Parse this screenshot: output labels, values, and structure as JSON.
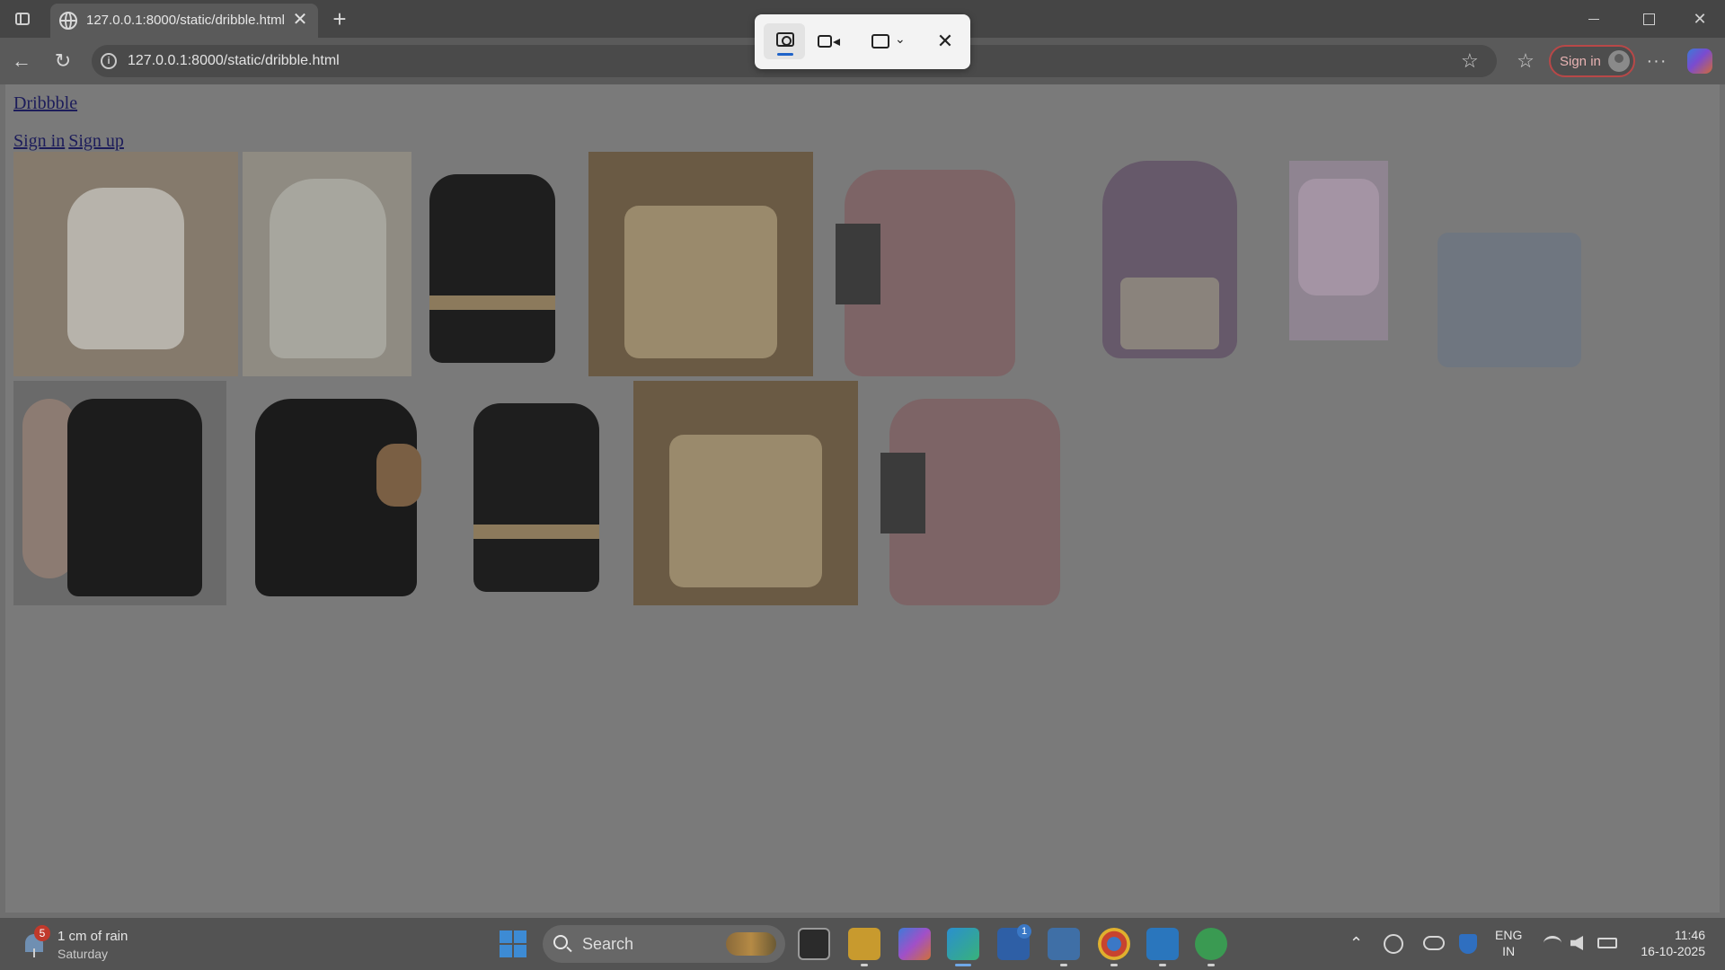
{
  "browser": {
    "tab_title": "127.0.0.1:8000/static/dribble.html",
    "tab_close_glyph": "✕",
    "new_tab_glyph": "+",
    "url": "127.0.0.1:8000/static/dribble.html",
    "info_glyph": "i",
    "back_glyph": "←",
    "refresh_glyph": "↻",
    "star_glyph": "☆",
    "favorites_glyph": "☆",
    "more_glyph": "···",
    "signin_label": "Sign in",
    "close_glyph": "✕"
  },
  "page": {
    "logo_link": "Dribbble",
    "signin_link": "Sign in",
    "signup_link": "Sign up",
    "images": [
      {
        "name": "white-mini-backpack",
        "color": "#8d8a85"
      },
      {
        "name": "cream-blue-backpack",
        "color": "#9e9a8e"
      },
      {
        "name": "black-beige-backpack",
        "color": "#7f7f7f"
      },
      {
        "name": "beige-tote-bear",
        "color": "#8a7558"
      },
      {
        "name": "pink-backpack-scarf",
        "color": "#877274"
      },
      {
        "name": "purple-backpack",
        "color": "#7f7880"
      },
      {
        "name": "pink-floral-backpack",
        "color": "#8d8087"
      },
      {
        "name": "blue-handbag",
        "color": "#7f858c"
      },
      {
        "name": "woman-black-backpack",
        "color": "#6d6d6d"
      },
      {
        "name": "black-bow-backpack-bear",
        "color": "#7a7a7a"
      },
      {
        "name": "black-beige-backpack-2",
        "color": "#7f7f7f"
      },
      {
        "name": "beige-tote-bear-2",
        "color": "#8a7558"
      },
      {
        "name": "pink-backpack-scarf-2",
        "color": "#877274"
      }
    ]
  },
  "snip_tool": {
    "close_glyph": "✕",
    "chevron_glyph": "⌄"
  },
  "taskbar": {
    "weather_badge": "5",
    "weather_line1": "1 cm of rain",
    "weather_line2": "Saturday",
    "search_label": "Search",
    "store_badge": "1",
    "tray_up_glyph": "⌃",
    "lang_line1": "ENG",
    "lang_line2": "IN",
    "time": "11:46",
    "date": "16-10-2025"
  }
}
